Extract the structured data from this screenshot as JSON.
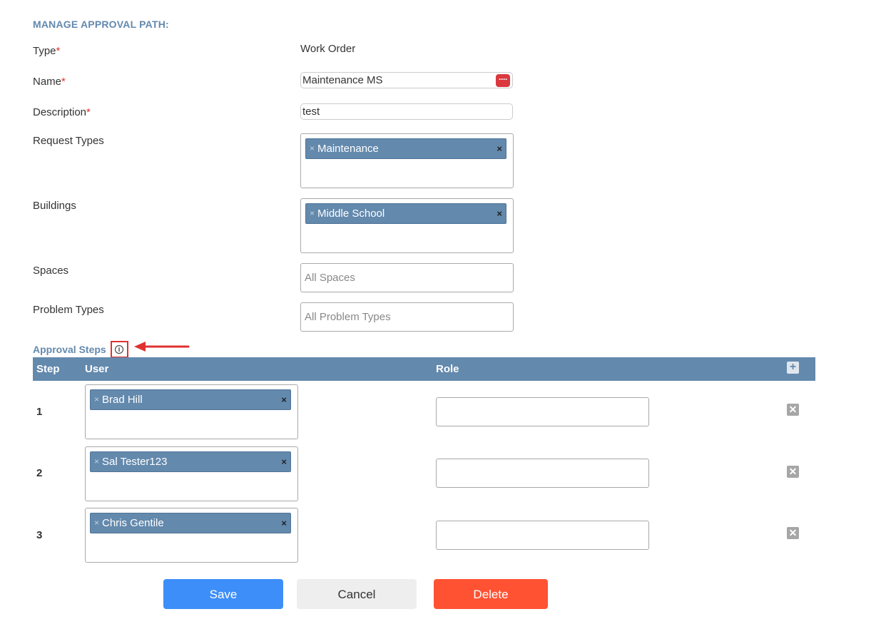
{
  "form": {
    "heading": "MANAGE APPROVAL PATH:",
    "required_marker": "*",
    "type": {
      "label": "Type",
      "value": "Work Order"
    },
    "name": {
      "label": "Name",
      "value": "Maintenance MS"
    },
    "description": {
      "label": "Description",
      "value": "test"
    },
    "request_types": {
      "label": "Request Types",
      "tags": [
        "Maintenance"
      ]
    },
    "buildings": {
      "label": "Buildings",
      "tags": [
        "Middle School"
      ]
    },
    "spaces": {
      "label": "Spaces",
      "placeholder": "All Spaces"
    },
    "problem_types": {
      "label": "Problem Types",
      "placeholder": "All Problem Types"
    }
  },
  "approval_steps": {
    "title": "Approval Steps",
    "info_icon": "info-circle-icon",
    "columns": {
      "step": "Step",
      "user": "User",
      "role": "Role"
    },
    "rows": [
      {
        "step": "1",
        "user": "Brad Hill",
        "role": ""
      },
      {
        "step": "2",
        "user": "Sal Tester123",
        "role": ""
      },
      {
        "step": "3",
        "user": "Chris Gentile",
        "role": ""
      }
    ]
  },
  "glyphs": {
    "remove_small": "×",
    "remove": "×",
    "add": "+",
    "delete_row": "✕",
    "dots": "····",
    "info": "i"
  },
  "buttons": {
    "save": "Save",
    "cancel": "Cancel",
    "delete": "Delete"
  },
  "colors": {
    "accent": "#6389ad",
    "save": "#3d8ef8",
    "delete": "#ff5233",
    "required": "#e03131"
  }
}
